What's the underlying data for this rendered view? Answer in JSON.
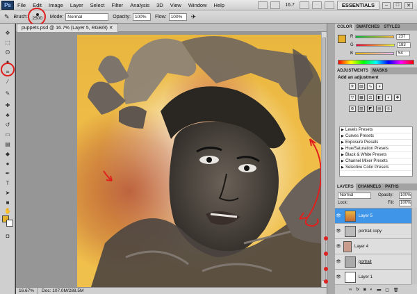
{
  "menubar": {
    "logo": "Ps",
    "items": [
      "File",
      "Edit",
      "Image",
      "Layer",
      "Select",
      "Filter",
      "Analysis",
      "3D",
      "View",
      "Window",
      "Help"
    ],
    "zoom": "16.7",
    "workspace": "ESSENTIALS"
  },
  "options": {
    "brush_label": "Brush:",
    "brush_size": "2500",
    "mode_label": "Mode:",
    "mode_value": "Normal",
    "opacity_label": "Opacity:",
    "opacity_value": "100%",
    "flow_label": "Flow:",
    "flow_value": "100%"
  },
  "document": {
    "tab_title": "puppets.psd @ 16.7% (Layer 5, RGB/8)"
  },
  "status": {
    "zoom": "16.67%",
    "doc": "Doc: 107.0M/288.5M"
  },
  "color_panel": {
    "tabs": [
      "COLOR",
      "SWATCHES",
      "STYLES"
    ],
    "fg_color": "#e7b22b",
    "r": "237",
    "g": "183",
    "b": "54"
  },
  "adjustments": {
    "tabs": [
      "ADJUSTMENTS",
      "MASKS"
    ],
    "heading": "Add an adjustment",
    "presets": [
      "Levels Presets",
      "Curves Presets",
      "Exposure Presets",
      "Hue/Saturation Presets",
      "Black & White Presets",
      "Channel Mixer Presets",
      "Selective Color Presets"
    ]
  },
  "layers_panel": {
    "tabs": [
      "LAYERS",
      "CHANNELS",
      "PATHS"
    ],
    "blend_mode": "Normal",
    "opacity_label": "Opacity:",
    "opacity_value": "100%",
    "lock_label": "Lock:",
    "fill_label": "Fill:",
    "fill_value": "100%",
    "layers": [
      {
        "name": "Layer 5",
        "selected": true
      },
      {
        "name": "portrait copy",
        "selected": false
      },
      {
        "name": "Layer 4",
        "selected": false
      },
      {
        "name": "portrait",
        "selected": false
      },
      {
        "name": "Layer 1",
        "selected": false
      }
    ]
  },
  "annotations": {
    "color": "#e0201e"
  }
}
